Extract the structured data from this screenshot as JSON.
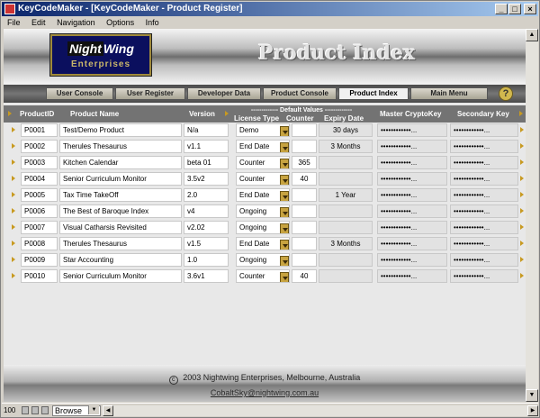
{
  "window": {
    "title": "KeyCodeMaker - [KeyCodeMaker - Product Register]"
  },
  "menu": [
    "File",
    "Edit",
    "Navigation",
    "Options",
    "Info"
  ],
  "logo": {
    "top_a": "Night",
    "top_b": "Wing",
    "bottom": "Enterprises"
  },
  "page_title": "Product Index",
  "nav": [
    {
      "label": "User Console",
      "active": false
    },
    {
      "label": "User Register",
      "active": false
    },
    {
      "label": "Developer Data",
      "active": false
    },
    {
      "label": "Product Console",
      "active": false
    },
    {
      "label": "Product Index",
      "active": true
    },
    {
      "label": "Main Menu",
      "active": false
    }
  ],
  "help_label": "?",
  "columns": {
    "product_id": "ProductID",
    "product_name": "Product Name",
    "version": "Version",
    "default_values": "------------- Default Values -------------",
    "license_type": "License Type",
    "counter": "Counter",
    "expiry_date": "Expiry Date",
    "master_key": "Master CryptoKey",
    "secondary_key": "Secondary Key"
  },
  "rows": [
    {
      "id": "P0001",
      "name": "Test/Demo Product",
      "version": "N/a",
      "license": "Demo",
      "counter": "",
      "expiry": "30 days",
      "master": "••••••••••••...",
      "secondary": "••••••••••••..."
    },
    {
      "id": "P0002",
      "name": "Therules Thesaurus",
      "version": "v1.1",
      "license": "End Date",
      "counter": "",
      "expiry": "3 Months",
      "master": "••••••••••••...",
      "secondary": "••••••••••••..."
    },
    {
      "id": "P0003",
      "name": "Kitchen Calendar",
      "version": "beta 01",
      "license": "Counter",
      "counter": "365",
      "expiry": "",
      "master": "••••••••••••...",
      "secondary": "••••••••••••..."
    },
    {
      "id": "P0004",
      "name": "Senior Curriculum Monitor",
      "version": "3.5v2",
      "license": "Counter",
      "counter": "40",
      "expiry": "",
      "master": "••••••••••••...",
      "secondary": "••••••••••••..."
    },
    {
      "id": "P0005",
      "name": "Tax Time TakeOff",
      "version": "2.0",
      "license": "End Date",
      "counter": "",
      "expiry": "1 Year",
      "master": "••••••••••••...",
      "secondary": "••••••••••••..."
    },
    {
      "id": "P0006",
      "name": "The Best of Baroque Index",
      "version": "v4",
      "license": "Ongoing",
      "counter": "",
      "expiry": "",
      "master": "••••••••••••...",
      "secondary": "••••••••••••..."
    },
    {
      "id": "P0007",
      "name": "Visual Catharsis Revisited",
      "version": "v2.02",
      "license": "Ongoing",
      "counter": "",
      "expiry": "",
      "master": "••••••••••••...",
      "secondary": "••••••••••••..."
    },
    {
      "id": "P0008",
      "name": "Therules Thesaurus",
      "version": "v1.5",
      "license": "End Date",
      "counter": "",
      "expiry": "3 Months",
      "master": "••••••••••••...",
      "secondary": "••••••••••••..."
    },
    {
      "id": "P0009",
      "name": "Star Accounting",
      "version": "1.0",
      "license": "Ongoing",
      "counter": "",
      "expiry": "",
      "master": "••••••••••••...",
      "secondary": "••••••••••••..."
    },
    {
      "id": "P0010",
      "name": "Senior Curriculum Monitor",
      "version": "3.6v1",
      "license": "Counter",
      "counter": "40",
      "expiry": "",
      "master": "••••••••••••...",
      "secondary": "••••••••••••..."
    }
  ],
  "footer": {
    "copyright_symbol": "c",
    "copyright": "2003 Nightwing Enterprises, Melbourne, Australia",
    "email": "CobaltSky@nightwing.com.au"
  },
  "status": {
    "zoom": "100",
    "mode": "Browse"
  },
  "colors": {
    "accent_gold": "#c89a20",
    "header_grey": "#737373",
    "logo_navy": "#0b0f5e"
  }
}
